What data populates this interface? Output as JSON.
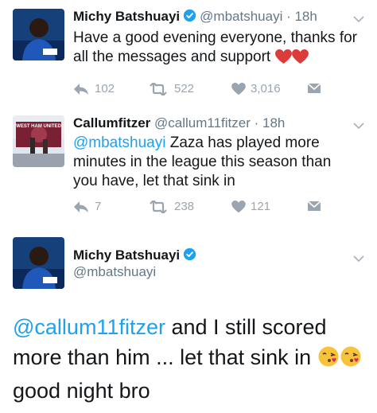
{
  "tweets": [
    {
      "name": "Michy Batshuayi",
      "handle": "@mbatshuayi",
      "time": "18h",
      "text": "Have a good evening everyone, thanks for all the messages and support",
      "replies": "102",
      "retweets": "522",
      "likes": "3,016"
    },
    {
      "name": "Callumfitzer",
      "handle": "@callum11fitzer",
      "time": "18h",
      "mention": "@mbatshuayi",
      "text": "Zaza has played more minutes in the league this season than you have, let that sink in",
      "replies": "7",
      "retweets": "238",
      "likes": "121"
    }
  ],
  "reply": {
    "name": "Michy Batshuayi",
    "handle": "@mbatshuayi",
    "mention": "@callum11fitzer",
    "text_part1": "and I still scored more than him ... let that sink in",
    "text_part2": "good night bro"
  },
  "avatar_badge_text": "WEST HAM UNITED",
  "colors": {
    "link": "#1da1f2",
    "muted": "#657786",
    "icon": "#9aa5b0",
    "verified": "#1da1f2",
    "heart": "#e0245e"
  },
  "icons": [
    "verified-icon",
    "chevron-down-icon",
    "reply-icon",
    "retweet-icon",
    "like-icon",
    "dm-icon",
    "heart-emoji-icon",
    "kiss-emoji-icon"
  ]
}
